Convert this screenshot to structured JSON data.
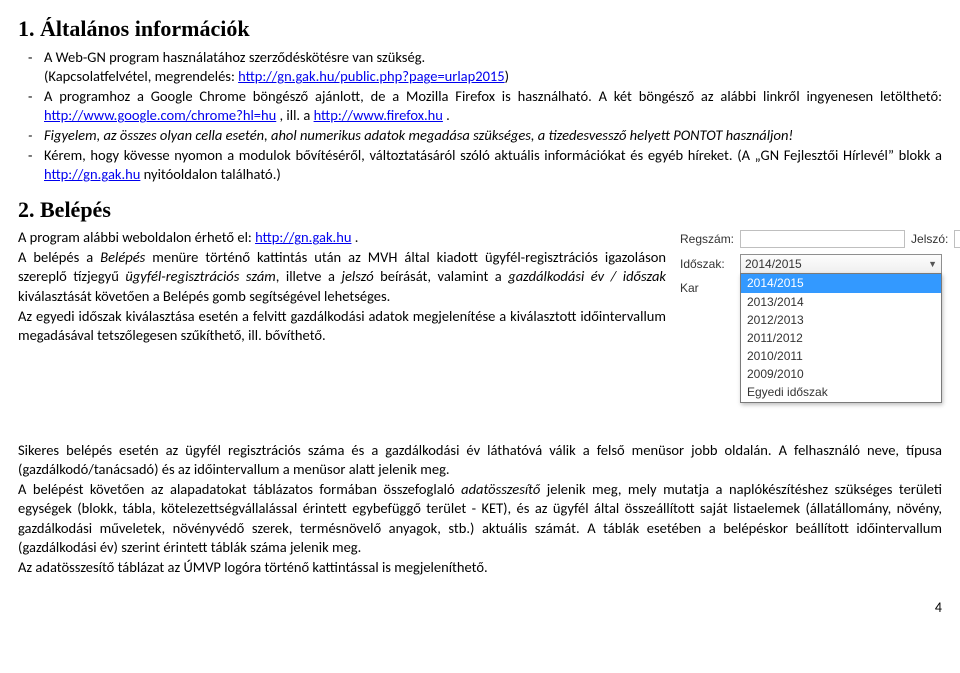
{
  "s1": {
    "heading": "1. Általános információk",
    "b1_a": "A Web-GN program használatához szerződéskötésre van szükség.",
    "b1_b": "(Kapcsolatfelvétel, megrendelés: ",
    "b1_link": "http://gn.gak.hu/public.php?page=urlap2015",
    "b1_c": ")",
    "b2_a": "A programhoz a Google Chrome böngésző ajánlott, de a Mozilla Firefox is használható. A két böngésző az alábbi linkről ingyenesen letölthető: ",
    "b2_link1": "http://www.google.com/chrome?hl=hu",
    "b2_mid": " , ill. a ",
    "b2_link2": "http://www.firefox.hu",
    "b2_end": " .",
    "b3": "Figyelem, az összes olyan cella esetén, ahol numerikus adatok megadása szükséges, a tizedesvessző helyett PONTOT használjon!",
    "b4_a": "Kérem, hogy kövesse nyomon a modulok bővítéséről, változtatásáról szóló aktuális információkat és egyéb híreket. (A „GN Fejlesztői Hírlevél” blokk a ",
    "b4_link": "http://gn.gak.hu",
    "b4_b": " nyitóoldalon található.)"
  },
  "s2": {
    "heading": "2. Belépés",
    "p1_a": "A program alábbi weboldalon érhető el: ",
    "p1_link": "http://gn.gak.hu",
    "p1_b": " .",
    "p2_a": "A belépés a ",
    "p2_i1": "Belépés",
    "p2_b": " menüre történő kattintás után az MVH által kiadott ügyfél-regisztrációs igazoláson szereplő tízjegyű ",
    "p2_i2": "ügyfél-regisztrációs szám",
    "p2_c": ", illetve a ",
    "p2_i3": "jelszó",
    "p2_d": " beírását, valamint a ",
    "p2_i4": "gazdálkodási év / időszak",
    "p2_e": " kiválasztását követően a Belépés gomb segítségével lehetséges.",
    "p3": "Az egyedi időszak kiválasztása esetén a felvitt gazdálkodási adatok megjelenítése a kiválasztott időintervallum megadásával tetszőlegesen szűkíthető, ill. bővíthető.",
    "p4": "Sikeres belépés esetén az ügyfél regisztrációs száma és a gazdálkodási év láthatóvá válik a felső menüsor jobb oldalán. A felhasználó neve, típusa (gazdálkodó/tanácsadó) és az időintervallum a menüsor alatt jelenik meg.",
    "p5_a": "A belépést követően az alapadatokat táblázatos formában összefoglaló ",
    "p5_i1": "adatösszesítő",
    "p5_b": " jelenik meg, mely mutatja a naplókészítéshez szükséges területi egységek (blokk, tábla, kötelezettségvállalással érintett egybefüggő terület - KET), és az ügyfél által összeállított saját listaelemek (állatállomány, növény, gazdálkodási műveletek, növényvédő szerek, termésnövelő anyagok, stb.) aktuális számát. A táblák esetében a belépéskor beállított időintervallum (gazdálkodási év) szerint érintett táblák száma jelenik meg.",
    "p6": "Az adatösszesítő táblázat az ÚMVP logóra történő kattintással is megjeleníthető."
  },
  "widget": {
    "reg_label": "Regszám:",
    "pw_label": "Jelszó:",
    "idoszak_label": "Időszak:",
    "kar_label": "Kar",
    "selected": "2014/2015",
    "options": [
      "2014/2015",
      "2013/2014",
      "2012/2013",
      "2011/2012",
      "2010/2011",
      "2009/2010",
      "Egyedi időszak"
    ]
  },
  "page_number": "4"
}
